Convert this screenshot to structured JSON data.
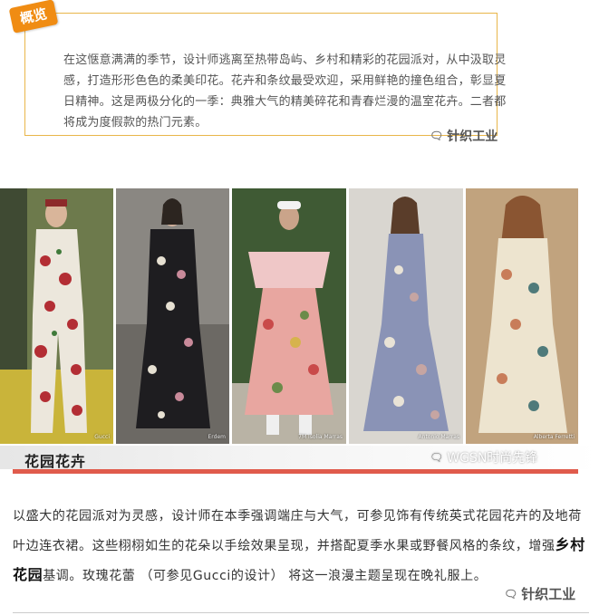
{
  "overview": {
    "tag": "概览",
    "text": "在这惬意满满的季节，设计师逃离至热带岛屿、乡村和精彩的花园派对，从中汲取灵感，打造形形色色的柔美印花。花卉和条纹最受欢迎，采用鲜艳的撞色组合，彰显夏日精神。这是两极分化的一季：典雅大气的精美碎花和青春烂漫的温室花卉。二者都将成为度假款的热门元素。"
  },
  "watermark_top": "针织工业",
  "watermark_mid": "WGSN时尚先锋",
  "watermark_bottom": "针织工业",
  "photos": [
    {
      "credit": "Gucci"
    },
    {
      "credit": "Erdem"
    },
    {
      "credit": "7M Isolia Marras"
    },
    {
      "credit": "Antonio Marras"
    },
    {
      "credit": "Alberta Ferretti"
    }
  ],
  "section": {
    "title": "花园花卉",
    "bar_color": "#e05b4c"
  },
  "body": {
    "part1": "以盛大的花园派对为灵感，设计师在本季强调端庄与大气，可参见饰有传统英式花园花卉的及地荷叶边连衣裙。这些栩栩如生的花朵以手绘效果呈现，并搭配夏季水果或野餐风格的条纹，增强",
    "highlight": "乡村花园",
    "part2": "基调。玫瑰花蕾 （可参见Gucci的设计） 将这一浪漫主题呈现在晚礼服上。"
  },
  "colors": {
    "accent_orange": "#f08c13",
    "frame_gold": "#e9b64a"
  }
}
